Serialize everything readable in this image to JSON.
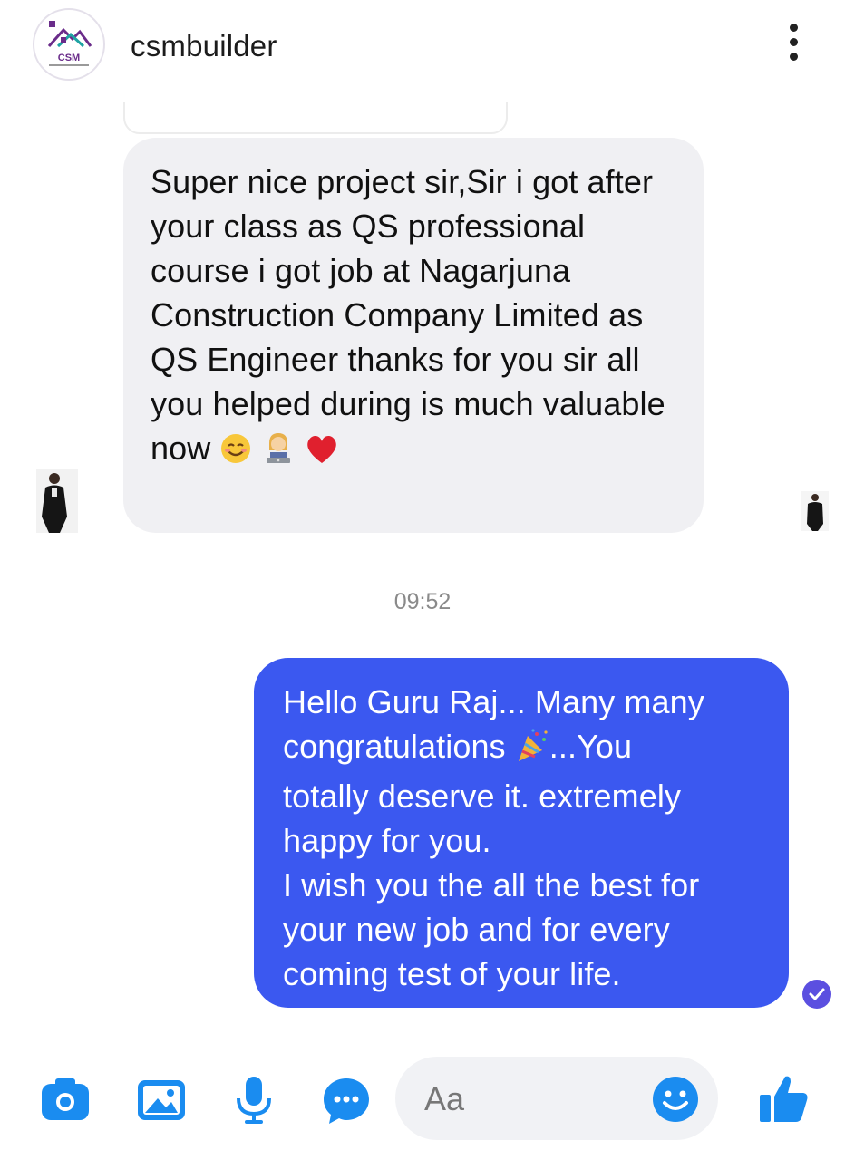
{
  "header": {
    "title": "csmbuilder",
    "logo_text": "CSM"
  },
  "messages": {
    "received_text": "Super nice project sir,Sir i got after your class as QS professional course i got job at Nagarjuna Construction Company Limited as QS Engineer thanks for you sir all you helped during is much valuable now",
    "received_emojis": [
      "smiling-face-icon",
      "technologist-icon",
      "red-heart-icon"
    ],
    "timestamp": "09:52",
    "sent_lines": [
      "Hello Guru Raj... Many many",
      "congratulations",
      "...You",
      "totally deserve it. extremely happy for you.",
      "I wish you the all the best for your new job and for every coming test of your life."
    ]
  },
  "composer": {
    "placeholder": "Aa",
    "icons": [
      "camera-icon",
      "gallery-icon",
      "microphone-icon",
      "chat-bubble-icon",
      "emoji-icon",
      "thumbs-up-icon"
    ]
  },
  "colors": {
    "sent_bubble": "#3b58f0",
    "received_bubble": "#f0f0f3",
    "accent": "#1a8cf0",
    "seen_badge": "#5b4fe0"
  }
}
